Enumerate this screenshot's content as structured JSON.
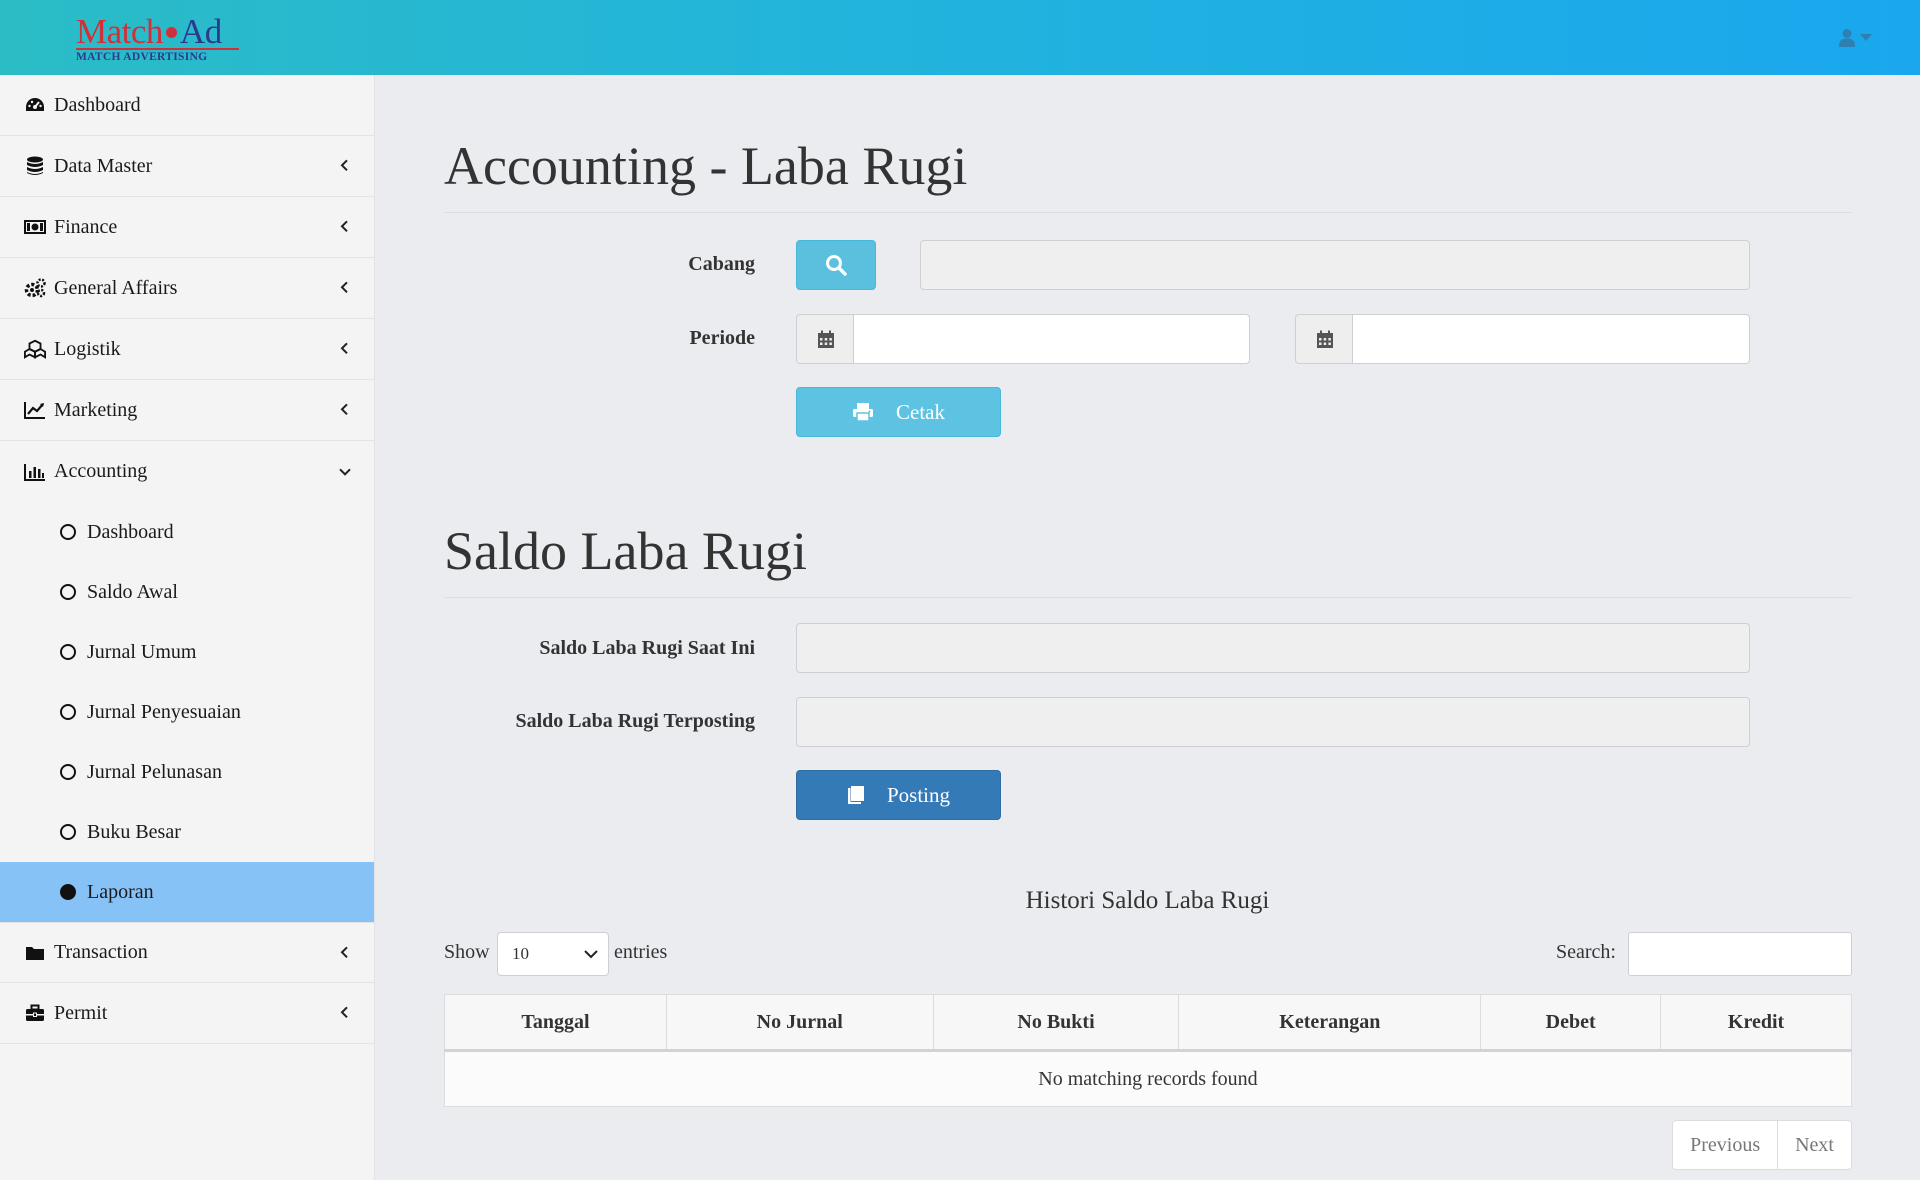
{
  "brand": {
    "logo_part1": "Match",
    "logo_part2": "Ad",
    "logo_tagline": "MATCH ADVERTISING"
  },
  "header": {
    "user_icon": "user-icon",
    "caret_icon": "caret-down-icon"
  },
  "sidebar": {
    "items": [
      {
        "label": "Dashboard",
        "icon": "dashboard-icon"
      },
      {
        "label": "Data Master",
        "icon": "database-icon"
      },
      {
        "label": "Finance",
        "icon": "money-icon"
      },
      {
        "label": "General Affairs",
        "icon": "gears-icon"
      },
      {
        "label": "Logistik",
        "icon": "cubes-icon"
      },
      {
        "label": "Marketing",
        "icon": "line-chart-icon"
      },
      {
        "label": "Accounting",
        "icon": "bar-chart-icon"
      }
    ],
    "accounting_sub": [
      {
        "label": "Dashboard"
      },
      {
        "label": "Saldo Awal"
      },
      {
        "label": "Jurnal Umum"
      },
      {
        "label": "Jurnal Penyesuaian"
      },
      {
        "label": "Jurnal Pelunasan"
      },
      {
        "label": "Buku Besar"
      },
      {
        "label": "Laporan"
      }
    ],
    "items_after": [
      {
        "label": "Transaction",
        "icon": "folder-icon"
      },
      {
        "label": "Permit",
        "icon": "briefcase-icon"
      }
    ],
    "active_color": "#87c2f7"
  },
  "main": {
    "title": "Accounting - Laba Rugi",
    "form": {
      "cabang_label": "Cabang",
      "cabang_value": "",
      "periode_label": "Periode",
      "periode_start": "",
      "periode_end": "",
      "print_label": "Cetak"
    },
    "saldo": {
      "title": "Saldo Laba Rugi",
      "current_label": "Saldo Laba Rugi Saat Ini",
      "current_value": "",
      "posted_label": "Saldo Laba Rugi Terposting",
      "posted_value": "",
      "posting_label": "Posting"
    },
    "history": {
      "caption": "Histori Saldo Laba Rugi",
      "show_label": "Show",
      "entries_value": "10",
      "entries_label": "entries",
      "search_label": "Search:",
      "search_value": "",
      "columns": [
        "Tanggal",
        "No Jurnal",
        "No Bukti",
        "Keterangan",
        "Debet",
        "Kredit"
      ],
      "empty_text": "No matching records found",
      "prev_label": "Previous",
      "next_label": "Next"
    }
  },
  "colors": {
    "header_from": "#2bbcc6",
    "header_to": "#1aa7ee",
    "btn_info": "#5bc0de",
    "btn_primary": "#337ab7"
  }
}
